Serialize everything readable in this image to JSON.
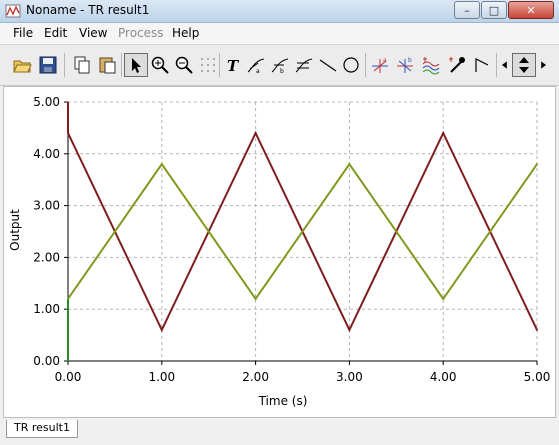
{
  "window": {
    "title": "Noname - TR result1"
  },
  "menu": {
    "file": "File",
    "edit": "Edit",
    "view": "View",
    "process": "Process",
    "help": "Help"
  },
  "toolbar": {
    "icons": [
      "open-folder-icon",
      "save-icon",
      "copy-icon",
      "paste-icon",
      "pointer-icon",
      "zoom-in-icon",
      "zoom-out-icon",
      "grid-icon",
      "text-icon",
      "cursor-a-icon",
      "cursor-b-icon",
      "cursor-c-icon",
      "line-icon",
      "circle-icon",
      "marker-a-icon",
      "marker-b-icon",
      "waves-icon",
      "eyedropper-icon",
      "corner-icon",
      "arrow-left-icon",
      "arrow-updown-icon",
      "arrow-right-icon"
    ]
  },
  "tabs": [
    "TR result1"
  ],
  "chart_data": {
    "type": "line",
    "xlabel": "Time (s)",
    "ylabel": "Output",
    "xlim": [
      0,
      5
    ],
    "ylim": [
      0,
      5
    ],
    "x_ticks": [
      "0.00",
      "1.00",
      "2.00",
      "3.00",
      "4.00",
      "5.00"
    ],
    "y_ticks": [
      "0.00",
      "1.00",
      "2.00",
      "3.00",
      "4.00",
      "5.00"
    ],
    "grid": true,
    "series": [
      {
        "color": "#7f1e1e",
        "points": [
          [
            0.0,
            4.4
          ],
          [
            1.0,
            0.6
          ],
          [
            2.0,
            4.4
          ],
          [
            3.0,
            0.6
          ],
          [
            4.0,
            4.4
          ],
          [
            5.0,
            0.6
          ]
        ]
      },
      {
        "color": "#7f9a1d",
        "points": [
          [
            0.0,
            1.2
          ],
          [
            1.0,
            3.8
          ],
          [
            2.0,
            1.2
          ],
          [
            3.0,
            3.8
          ],
          [
            4.0,
            1.2
          ],
          [
            5.0,
            3.8
          ]
        ]
      }
    ],
    "initial_spike": {
      "color": "#2a8a2a",
      "points": [
        [
          0.0,
          0.0
        ],
        [
          0.0,
          1.2
        ]
      ]
    },
    "initial_vertical": {
      "color": "#7f1e1e",
      "points": [
        [
          0.0,
          5.0
        ],
        [
          0.0,
          4.4
        ]
      ]
    }
  }
}
